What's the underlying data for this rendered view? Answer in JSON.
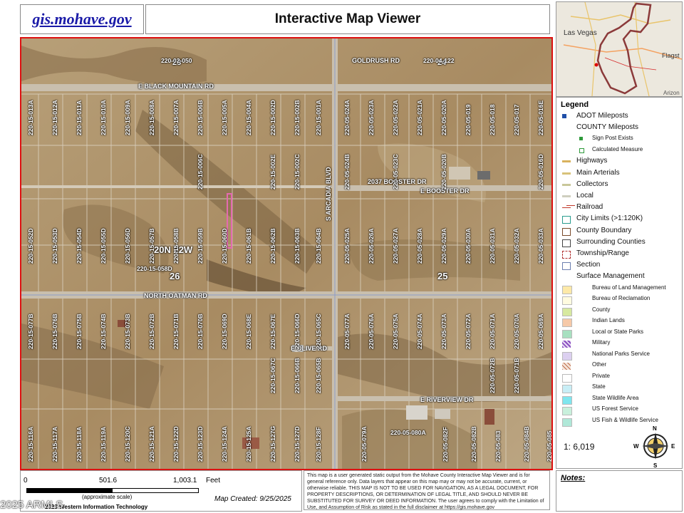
{
  "header": {
    "logo": "gis.mohave.gov",
    "title": "Interactive Map Viewer"
  },
  "inset": {
    "city1": "Las Vegas",
    "city2": "Flagst",
    "city3": "Arizon"
  },
  "map": {
    "roads": {
      "goldrush": "GOLDRUSH RD",
      "black_mountain": "E BLACK MOUNTAIN RD",
      "booster_dr_label": "2037 BOOSTER DR",
      "e_booster": "E BOOSTER DR",
      "arcadia": "S ARCADIA BLVD",
      "north_oatman": "NORTH OATMAN RD",
      "olive": "E OLIVE RD",
      "riverview": "E RIVERVIEW DR"
    },
    "township": "20N 22W",
    "sections": {
      "s24": "24",
      "s25": "25",
      "s26": "26",
      "s23": "23"
    },
    "parcels_top": [
      "220-02-050",
      "220-04-122"
    ],
    "parcels_row1": [
      "220-15-013A",
      "220-15-012A",
      "220-15-011A",
      "220-15-010A",
      "220-15-009A",
      "220-15-008A",
      "220-15-007A",
      "220-15-006B",
      "220-15-005A",
      "220-15-004A",
      "220-15-002D",
      "220-15-002B",
      "220-15-001A",
      "220-05-024A",
      "220-05-023A",
      "220-05-022A",
      "220-05-021A",
      "220-05-020A",
      "220-05-019",
      "220-05-018",
      "220-05-017",
      "220-05-016E"
    ],
    "parcels_row1_mid": [
      "220-15-006C",
      "220-15-002E",
      "220-15-002C",
      "220-05-024B",
      "220-05-023C",
      "220-05-020B",
      "220-05-016D"
    ],
    "parcels_row2": [
      "220-15-052D",
      "220-15-053D",
      "220-15-054D",
      "220-15-055D",
      "220-15-056D",
      "220-15-057B",
      "220-15-058B",
      "220-15-059B",
      "220-15-060D",
      "220-15-061B",
      "220-15-062B",
      "220-15-063B",
      "220-15-064B",
      "220-05-025A",
      "220-05-026A",
      "220-05-027A",
      "220-05-028A",
      "220-05-029A",
      "220-05-030A",
      "220-05-031A",
      "220-05-032A",
      "220-05-033A"
    ],
    "parcel_058d": "220-15-058D",
    "parcels_row3": [
      "220-15-077B",
      "220-15-076B",
      "220-15-075B",
      "220-15-074B",
      "220-15-073B",
      "220-15-072B",
      "220-15-071B",
      "220-15-070B",
      "220-15-069D",
      "220-15-068E",
      "220-15-067E",
      "220-15-066D",
      "220-15-065C",
      "220-05-077A",
      "220-05-076A",
      "220-05-075A",
      "220-05-074A",
      "220-05-073A",
      "220-05-072A",
      "220-05-071A",
      "220-05-070A",
      "220-05-069A"
    ],
    "parcels_row3_low": [
      "220-15-067C",
      "220-15-066B",
      "220-15-065B",
      "220-05-072B",
      "220-05-071B"
    ],
    "parcels_row4": [
      "220-15-116A",
      "220-15-117A",
      "220-15-118A",
      "220-15-119A",
      "220-15-120C",
      "220-15-121A",
      "220-15-122D",
      "220-15-123D",
      "220-15-124A",
      "220-15-125A",
      "220-15-127G",
      "220-15-127D",
      "220-15-128F",
      "220-05-079A",
      "220-05-082F",
      "220-05-082B",
      "220-05-083",
      "220-05-084B",
      "220-05-085"
    ],
    "parcel_080a": "220-05-080A"
  },
  "legend": {
    "title": "Legend",
    "items": [
      {
        "label": "ADOT Mileposts",
        "sub": false,
        "color": "#1f4fa8",
        "kind": "square"
      },
      {
        "label": "COUNTY Mileposts",
        "sub": false,
        "color": "",
        "kind": "none"
      },
      {
        "label": "Sign Post Exists",
        "sub": true,
        "color": "#2e9a3a",
        "kind": "smallsquare"
      },
      {
        "label": "Calculated Measure",
        "sub": true,
        "color": "#2e9a3a",
        "kind": "outline"
      },
      {
        "label": "Highways",
        "sub": false,
        "color": "#d9b25e",
        "kind": "line"
      },
      {
        "label": "Main Arterials",
        "sub": false,
        "color": "#d8c27a",
        "kind": "line"
      },
      {
        "label": "Collectors",
        "sub": false,
        "color": "#c9c79a",
        "kind": "line"
      },
      {
        "label": "Local",
        "sub": false,
        "color": "#cfcfbf",
        "kind": "line"
      },
      {
        "label": "Railroad",
        "sub": false,
        "color": "#c0392b",
        "kind": "rail"
      },
      {
        "label": "City Limits (>1:120K)",
        "sub": false,
        "color": "#2a9d8f",
        "kind": "box"
      },
      {
        "label": "County Boundary",
        "sub": false,
        "color": "#7a4a2a",
        "kind": "box"
      },
      {
        "label": "Surrounding Counties",
        "sub": false,
        "color": "#444444",
        "kind": "box"
      },
      {
        "label": "Township/Range",
        "sub": false,
        "color": "#b03030",
        "kind": "dashbox"
      },
      {
        "label": "Section",
        "sub": false,
        "color": "#6c7fb0",
        "kind": "box"
      },
      {
        "label": "Surface Management",
        "sub": false,
        "color": "",
        "kind": "none"
      },
      {
        "label": "Bureau of Land Management",
        "sub": true,
        "color": "#fde9a8",
        "kind": "fill"
      },
      {
        "label": "Bureau of Reclamation",
        "sub": true,
        "color": "#fffbe0",
        "kind": "fill"
      },
      {
        "label": "County",
        "sub": true,
        "color": "#d7e9a0",
        "kind": "fill"
      },
      {
        "label": "Indian Lands",
        "sub": true,
        "color": "#f6c9a8",
        "kind": "fill"
      },
      {
        "label": "Local or State Parks",
        "sub": true,
        "color": "#a8e0c0",
        "kind": "fill"
      },
      {
        "label": "Military",
        "sub": true,
        "color": "#c9a8e0",
        "kind": "hatch"
      },
      {
        "label": "National Parks Service",
        "sub": true,
        "color": "#dcd0f0",
        "kind": "fill"
      },
      {
        "label": "Other",
        "sub": true,
        "color": "#f0d8c8",
        "kind": "hatch2"
      },
      {
        "label": "Private",
        "sub": true,
        "color": "#ffffff",
        "kind": "fill"
      },
      {
        "label": "State",
        "sub": true,
        "color": "#c8eef6",
        "kind": "fill"
      },
      {
        "label": "State Wildlife Area",
        "sub": true,
        "color": "#7fe6ee",
        "kind": "fill"
      },
      {
        "label": "US Forest Service",
        "sub": true,
        "color": "#c8f0dc",
        "kind": "fill"
      },
      {
        "label": "US Fish & Wildlife Service",
        "sub": true,
        "color": "#b0e8d8",
        "kind": "fill"
      }
    ],
    "scale": "1: 6,019",
    "compass": {
      "n": "N",
      "s": "S",
      "e": "E",
      "w": "W"
    }
  },
  "scalebar": {
    "t0": "0",
    "t1": "501.6",
    "t2": "1,003.1",
    "unit": "Feet",
    "approx": "(approximate scale)",
    "created": "Map Created: 9/25/2025",
    "credit": "2023 Western Information Technology"
  },
  "disclaimer": "This map is a user generated static output from the Mohave County Interactive Map Viewer and is for general reference only. Data layers that appear on this map may or may not be accurate, current, or otherwise reliable. THIS MAP IS NOT TO BE USED FOR NAVIGATION, AS A LEGAL DOCUMENT, FOR PROPERTY DESCRIPTIONS, OR DETERMINATION OF LEGAL TITLE, AND SHOULD NEVER BE SUBSTITUTED FOR SURVEY OR DEED INFORMATION. The user agrees to comply with the Limitation of Use, and Assumption of Risk as stated in the full disclaimer at https://gis.mohave.gov",
  "notes": "Notes:",
  "watermark": "2025 ARMLS"
}
